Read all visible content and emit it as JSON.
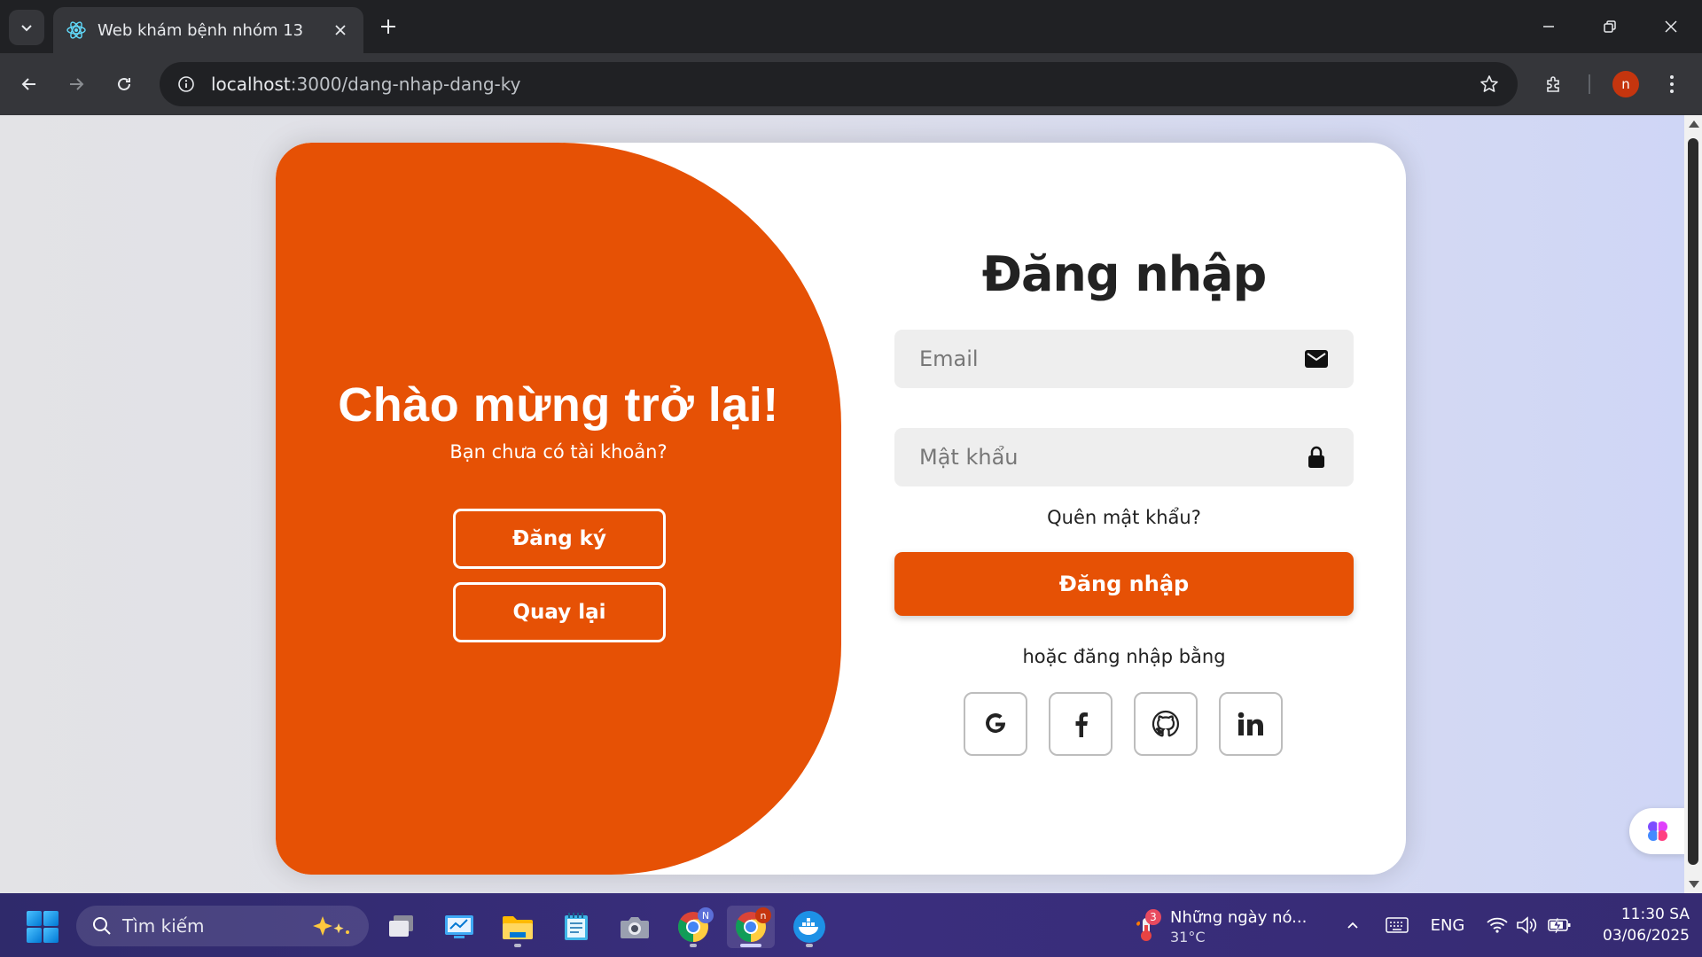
{
  "browser": {
    "tab_title": "Web khám bệnh nhóm 13",
    "url_host": "localhost",
    "url_path": ":3000/dang-nhap-dang-ky",
    "profile_initial": "n"
  },
  "welcome": {
    "heading": "Chào mừng trở lại!",
    "subtext": "Bạn chưa có tài khoản?",
    "register_label": "Đăng ký",
    "back_label": "Quay lại"
  },
  "login": {
    "title": "Đăng nhập",
    "email_placeholder": "Email",
    "password_placeholder": "Mật khẩu",
    "forgot": "Quên mật khẩu?",
    "submit_label": "Đăng nhập",
    "or_text": "hoặc đăng nhập bằng",
    "social": [
      {
        "name": "google-icon",
        "glyph": "G"
      },
      {
        "name": "facebook-icon",
        "glyph": "f"
      },
      {
        "name": "github-icon",
        "glyph": ""
      },
      {
        "name": "linkedin-icon",
        "glyph": "in"
      }
    ]
  },
  "taskbar": {
    "search_label": "Tìm kiếm",
    "weather_title": "Những ngày nó...",
    "weather_temp": "31°C",
    "weather_badge": "3",
    "chrome_badge_1": "N",
    "chrome_badge_2": "n",
    "language": "ENG",
    "time": "11:30 SA",
    "date": "03/06/2025"
  },
  "colors": {
    "brand_orange": "#e65105",
    "page_bg": "#e3e3e6"
  }
}
